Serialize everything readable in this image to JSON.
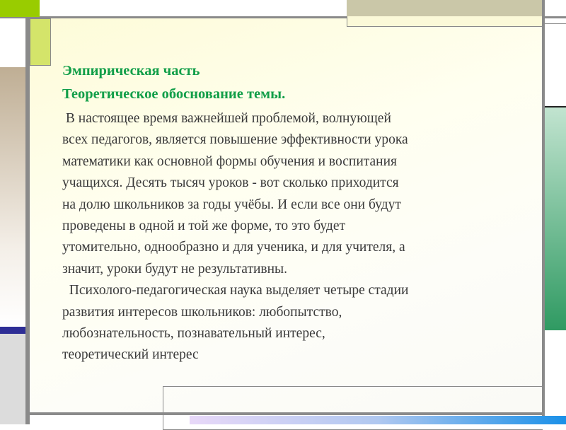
{
  "slide": {
    "title_1": "Эмпирическая часть",
    "title_2": "Теоретическое обоснование темы.",
    "body_lines": [
      " В настоящее время важнейшей проблемой, волнующей",
      "всех педагогов, является повышение эффективности урока",
      "математики как основной формы обучения и воспитания",
      "учащихся. Десять тысяч уроков - вот сколько приходится",
      "на долю школьников за годы учёбы. И если все они будут",
      "проведены в одной и той же форме, то это будет",
      "утомительно, однообразно и для ученика, и для учителя, а",
      "значит, уроки будут не результативны.",
      "  Психолого-педагогическая наука выделяет четыре стадии",
      "развития интересов школьников: любопытство,",
      "любознательность, познавательный интерес,",
      "теоретический интерес"
    ]
  },
  "colors": {
    "title": "#119e48",
    "text": "#3a3a3a",
    "accent_green": "#99cc00",
    "accent_blue": "#2e2e96"
  }
}
